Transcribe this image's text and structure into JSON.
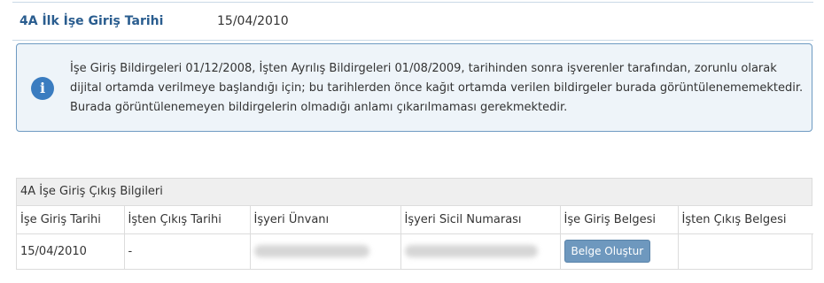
{
  "summary": {
    "label": "4A İlk İşe Giriş Tarihi",
    "value": "15/04/2010"
  },
  "info": {
    "icon": "info-icon",
    "icon_glyph": "i",
    "accent_color": "#3a7cc0",
    "text": "İşe Giriş Bildirgeleri 01/12/2008, İşten Ayrılış Bildirgeleri 01/08/2009, tarihinden sonra işverenler tarafından, zorunlu olarak dijital ortamda verilmeye başlandığı için; bu tarihlerden önce kağıt ortamda verilen bildirgeler burada görüntülenememektedir. Burada görüntülenemeyen bildirgelerin olmadığı anlamı çıkarılmaması gerekmektedir."
  },
  "panel": {
    "title": "4A İşe Giriş Çıkış Bilgileri",
    "columns": [
      "İşe Giriş Tarihi",
      "İşten Çıkış Tarihi",
      "İşyeri Ünvanı",
      "İşyeri Sicil Numarası",
      "İşe Giriş Belgesi",
      "İşten Çıkış Belgesi"
    ],
    "rows": [
      {
        "giris_tarihi": "15/04/2010",
        "cikis_tarihi": "-",
        "isyeri_unvani": "",
        "isyeri_sicil": "",
        "giris_belgesi_button": "Belge Oluştur",
        "cikis_belgesi": ""
      }
    ]
  }
}
